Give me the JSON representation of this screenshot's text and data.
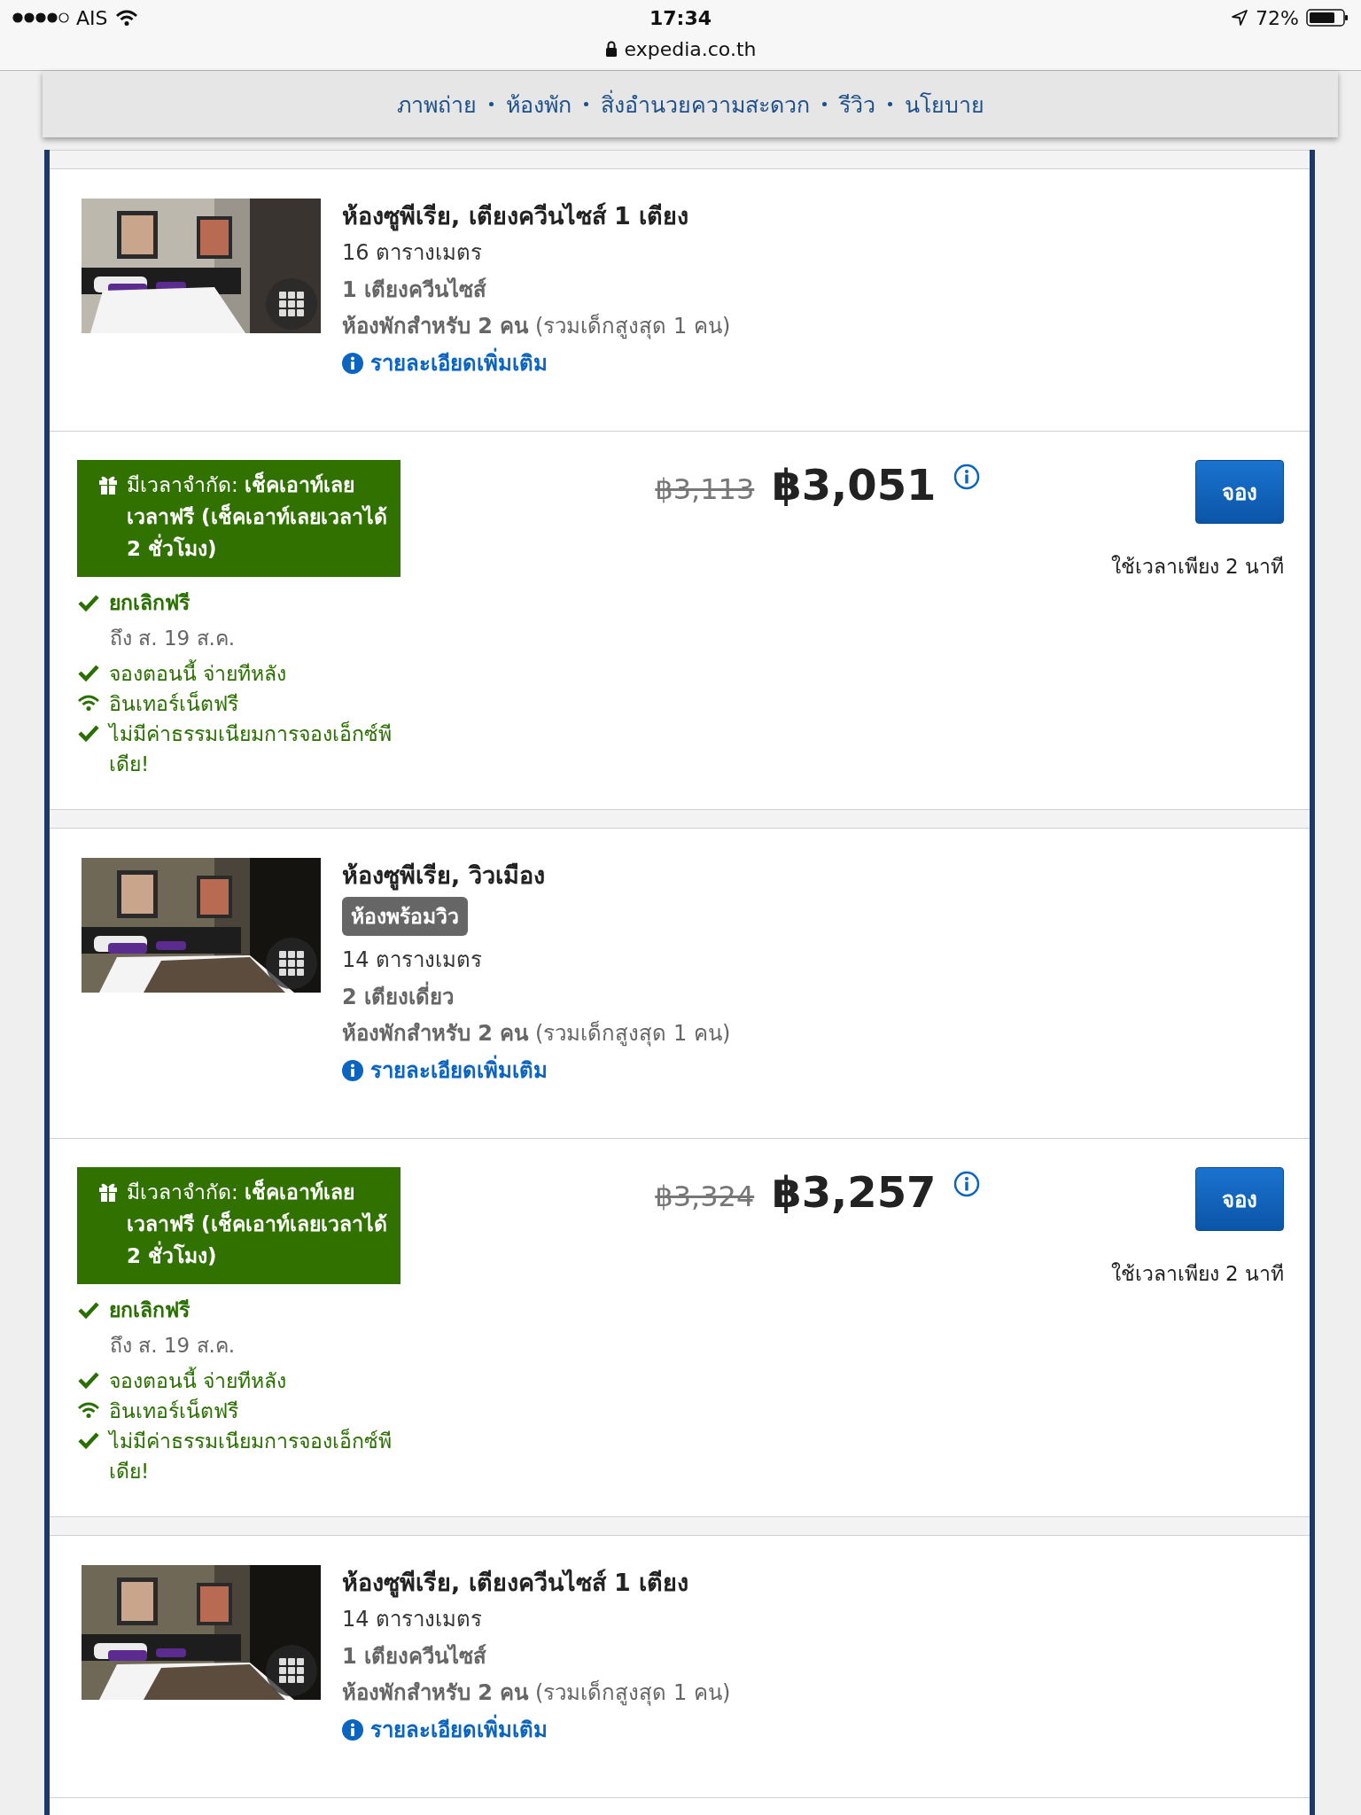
{
  "status_bar": {
    "carrier": "AIS",
    "time": "17:34",
    "url": "expedia.co.th",
    "battery": "72%"
  },
  "nav": {
    "items": [
      "ภาพถ่าย",
      "ห้องพัก",
      "สิ่งอำนวยความสะดวก",
      "รีวิว",
      "นโยบาย"
    ]
  },
  "rooms": [
    {
      "title": "ห้องซูพีเรีย, เตียงควีนไซส์ 1 เตียง",
      "size": "16 ตารางเมตร",
      "beds": "1 เตียงควีนไซส์",
      "occupancy": "**ห้องพักสำหรับ 2 คน** (รวมเด็กสูงสุด 1 คน)",
      "details_link": "รายละเอียดเพิ่มเติม",
      "offer": {
        "promo": "มีเวลาจำกัด: **เช็คเอาท์เลยเวลาฟรี (เช็คเอาท์เลยเวลาได้ 2 ชั่วโมง)**",
        "cancellation": {
          "label": "ยกเลิกฟรี",
          "until": "ถึง ส. 19 ส.ค."
        },
        "perks": [
          {
            "kind": "check",
            "text": "จองตอนนี้ จ่ายทีหลัง"
          },
          {
            "kind": "wifi",
            "text": "อินเทอร์เน็ตฟรี"
          },
          {
            "kind": "check",
            "text": "ไม่มีค่าธรรมเนียมการจองเอ็กซ์พีเดีย!"
          }
        ],
        "old_price": "฿3,113",
        "price": "฿3,051",
        "book_button": "จอง",
        "booking_note": "ใช้เวลาเพียง 2 นาที"
      }
    },
    {
      "title": "ห้องซูพีเรีย, วิวเมือง",
      "badge": "ห้องพร้อมวิว",
      "size": "14 ตารางเมตร",
      "beds": "2 เตียงเดี่ยว",
      "occupancy": "**ห้องพักสำหรับ 2 คน** (รวมเด็กสูงสุด 1 คน)",
      "details_link": "รายละเอียดเพิ่มเติม",
      "offer": {
        "promo": "มีเวลาจำกัด: **เช็คเอาท์เลยเวลาฟรี (เช็คเอาท์เลยเวลาได้ 2 ชั่วโมง)**",
        "cancellation": {
          "label": "ยกเลิกฟรี",
          "until": "ถึง ส. 19 ส.ค."
        },
        "perks": [
          {
            "kind": "check",
            "text": "จองตอนนี้ จ่ายทีหลัง"
          },
          {
            "kind": "wifi",
            "text": "อินเทอร์เน็ตฟรี"
          },
          {
            "kind": "check",
            "text": "ไม่มีค่าธรรมเนียมการจองเอ็กซ์พีเดีย!"
          }
        ],
        "old_price": "฿3,324",
        "price": "฿3,257",
        "book_button": "จอง",
        "booking_note": "ใช้เวลาเพียง 2 นาที"
      }
    },
    {
      "title": "ห้องซูพีเรีย, เตียงควีนไซส์ 1 เตียง",
      "size": "14 ตารางเมตร",
      "beds": "1 เตียงควีนไซส์",
      "occupancy": "**ห้องพักสำหรับ 2 คน** (รวมเด็กสูงสุด 1 คน)",
      "details_link": "รายละเอียดเพิ่มเติม"
    }
  ]
}
